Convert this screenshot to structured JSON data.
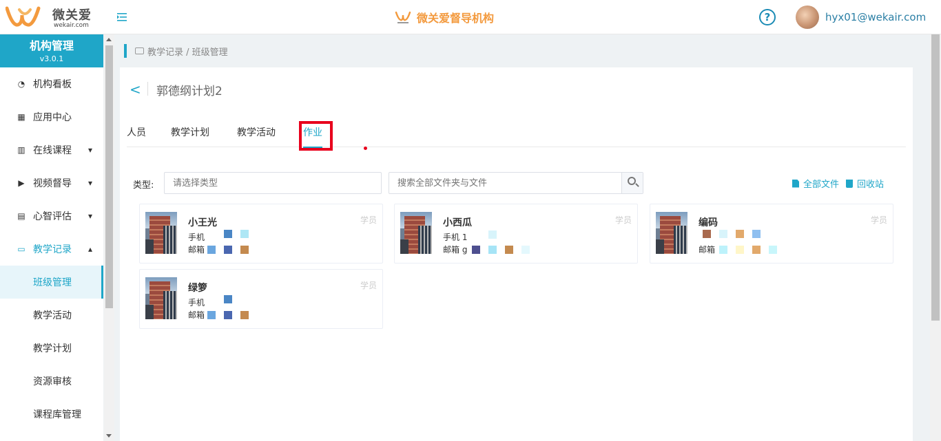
{
  "header": {
    "logo_text": "微关爱",
    "logo_sub": "wekair.com",
    "brand_title": "微关爱督导机构",
    "help_symbol": "?",
    "user_email": "hyx01@wekair.com"
  },
  "sidebar": {
    "title": "机构管理",
    "version": "v3.0.1",
    "items": [
      {
        "label": "机构看板",
        "icon": "dashboard-icon"
      },
      {
        "label": "应用中心",
        "icon": "grid-icon"
      },
      {
        "label": "在线课程",
        "icon": "book-icon",
        "chevron": "▾"
      },
      {
        "label": "视频督导",
        "icon": "play-icon",
        "chevron": "▾"
      },
      {
        "label": "心智评估",
        "icon": "report-icon",
        "chevron": "▾"
      },
      {
        "label": "教学记录",
        "icon": "video-icon",
        "chevron": "▴"
      }
    ],
    "subitems": [
      "班级管理",
      "教学活动",
      "教学计划",
      "资源审核",
      "课程库管理"
    ]
  },
  "breadcrumb": "教学记录 / 班级管理",
  "page": {
    "back_symbol": "<",
    "title": "郭德纲计划2"
  },
  "tabs": [
    "人员",
    "教学计划",
    "教学活动",
    "作业"
  ],
  "filters": {
    "type_label": "类型:",
    "type_placeholder": "请选择类型",
    "search_placeholder": "搜索全部文件夹与文件",
    "all_files": "全部文件",
    "recycle_bin": "回收站"
  },
  "cards": [
    {
      "name": "小王光",
      "role": "学员",
      "line1": "手机",
      "line2": "邮箱"
    },
    {
      "name": "小西瓜",
      "role": "学员",
      "line1": "手机 1",
      "line2": "邮箱 g"
    },
    {
      "name": "编码",
      "role": "学员",
      "line1": "",
      "line2": "邮箱"
    },
    {
      "name": "绿箩",
      "role": "学员",
      "line1": "手机",
      "line2": "邮箱"
    }
  ],
  "colors": {
    "accent": "#1fa6c8",
    "brand_orange": "#f39a3e",
    "highlight_red": "#e8001c"
  }
}
